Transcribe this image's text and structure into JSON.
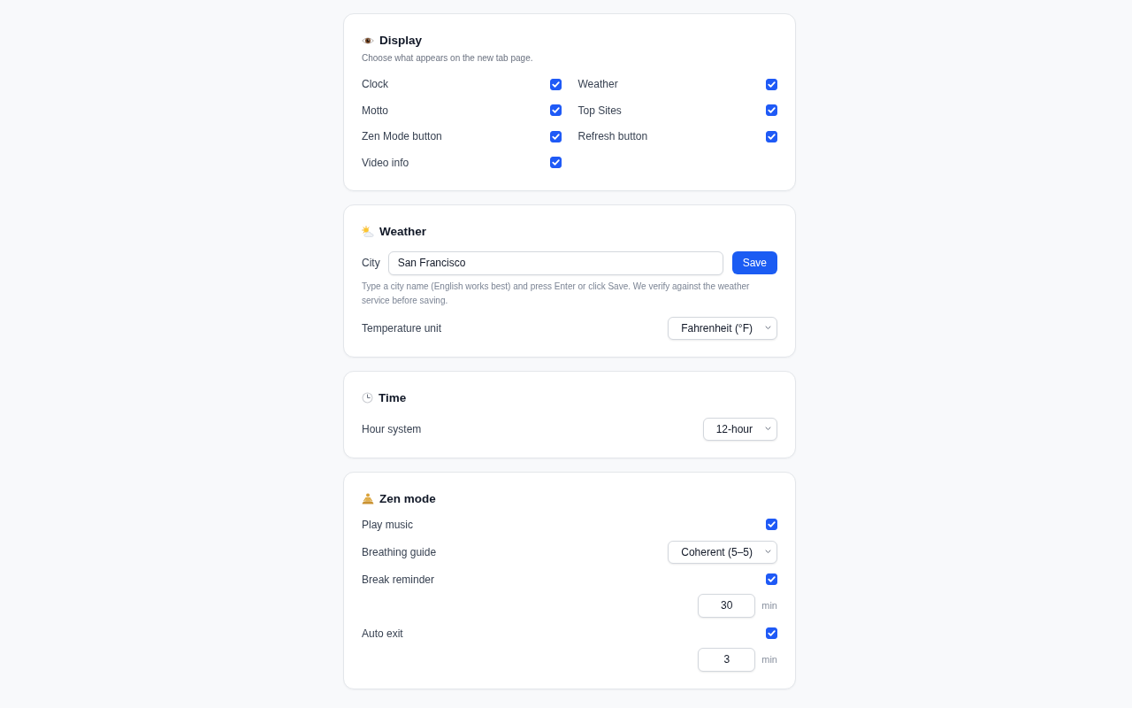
{
  "display": {
    "title": "Display",
    "subtitle": "Choose what appears on the new tab page.",
    "items": [
      {
        "label": "Clock",
        "checked": true
      },
      {
        "label": "Weather",
        "checked": true
      },
      {
        "label": "Motto",
        "checked": true
      },
      {
        "label": "Top Sites",
        "checked": true
      },
      {
        "label": "Zen Mode button",
        "checked": true
      },
      {
        "label": "Refresh button",
        "checked": true
      },
      {
        "label": "Video info",
        "checked": true
      }
    ]
  },
  "weather": {
    "title": "Weather",
    "city": {
      "label": "City",
      "value": "San Francisco"
    },
    "save_button": "Save",
    "help": "Type a city name (English works best) and press Enter or click Save. We verify against the weather service before saving.",
    "temperature_unit": {
      "label": "Temperature unit",
      "value": "Fahrenheit (°F)"
    }
  },
  "time": {
    "title": "Time",
    "hour_system": {
      "label": "Hour system",
      "value": "12-hour"
    }
  },
  "zen_mode": {
    "title": "Zen mode",
    "rows": [
      {
        "kind": "checkbox",
        "label": "Play music",
        "checked": true
      },
      {
        "kind": "select",
        "label": "Breathing guide",
        "value": "Coherent (5–5)"
      },
      {
        "kind": "checkbox",
        "label": "Break reminder",
        "checked": true,
        "number": "30",
        "unit": "min"
      },
      {
        "kind": "checkbox",
        "label": "Auto exit",
        "checked": true,
        "number": "3",
        "unit": "min"
      }
    ]
  }
}
